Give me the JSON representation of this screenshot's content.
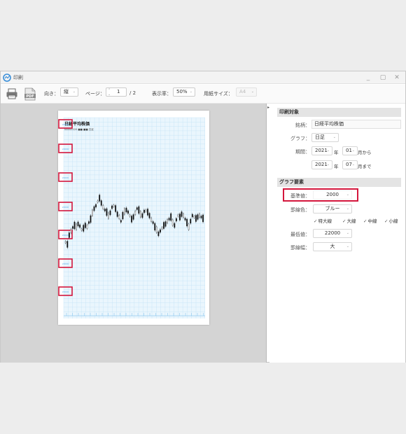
{
  "window": {
    "title": "印刷"
  },
  "toolbar": {
    "orientation_label": "向き：",
    "orientation_value": "縦",
    "page_label": "ページ：",
    "page_current": "1",
    "page_total": "/ 2",
    "zoom_label": "表示率：",
    "zoom_value": "50%",
    "paper_label": "用紙サイズ：",
    "paper_value": "A4",
    "pdf_text": "PDF"
  },
  "preview": {
    "doc_title": "日経平均株価",
    "doc_subtitle": "N0000220 ■■ ■■ 日足",
    "axis_label_text": "20000"
  },
  "panel": {
    "print_target": {
      "heading": "印刷対象",
      "symbol_label": "銘柄：",
      "symbol_value": "日経平均株価",
      "graph_label": "グラフ：",
      "graph_value": "日足",
      "period_label": "期間：",
      "from_year": "2021",
      "year_unit": "年",
      "from_month": "01",
      "from_suffix": "月から",
      "to_year": "2021",
      "to_month": "07",
      "to_suffix": "月まで"
    },
    "graph_elements": {
      "heading": "グラフ要素",
      "base_label": "基準値：",
      "base_value": "2000",
      "line_color_label": "罫線色：",
      "line_color_value": "ブルー",
      "checks": [
        {
          "label": "特大線",
          "checked": true
        },
        {
          "label": "大線",
          "checked": true
        },
        {
          "label": "中線",
          "checked": true
        },
        {
          "label": "小線",
          "checked": true
        }
      ],
      "min_label": "最低値：",
      "min_value": "22000",
      "width_label": "罫線幅：",
      "width_value": "大"
    }
  },
  "colors": {
    "highlight": "#d4163c",
    "grid": "#bfe0f5",
    "grid_fill": "#eaf6fd",
    "candle": "#111111"
  }
}
